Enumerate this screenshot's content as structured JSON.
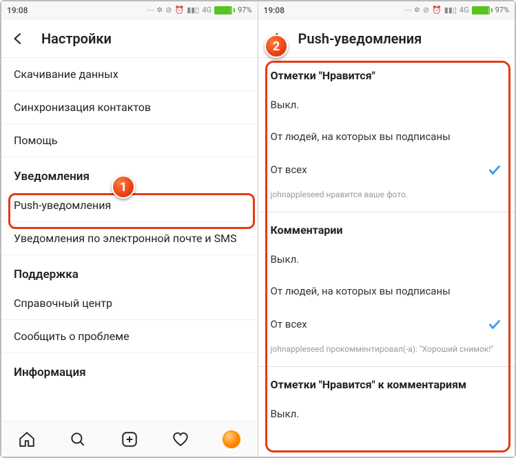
{
  "statusbar": {
    "time": "19:08",
    "network": "4G",
    "battery_pct": "97%"
  },
  "screen_left": {
    "title": "Настройки",
    "rows": {
      "download_data": "Скачивание данных",
      "sync_contacts": "Синхронизация контактов",
      "help": "Помощь"
    },
    "notifications_section": "Уведомления",
    "push_notifications": "Push-уведомления",
    "email_sms_notifications": "Уведомления по электронной почте и SMS",
    "support_section": "Поддержка",
    "help_center": "Справочный центр",
    "report_problem": "Сообщить о проблеме",
    "info_section": "Информация"
  },
  "screen_right": {
    "title": "Push-уведомления",
    "likes": {
      "heading": "Отметки \"Нравится\"",
      "opt_off": "Выкл.",
      "opt_following": "От людей, на которых вы подписаны",
      "opt_everyone": "От всех",
      "caption": "johnappleseed нравится ваше фото."
    },
    "comments": {
      "heading": "Комментарии",
      "opt_off": "Выкл.",
      "opt_following": "От людей, на которых вы подписаны",
      "opt_everyone": "От всех",
      "caption": "johnappleseed прокомментировал(-а): \"Хороший снимок!\""
    },
    "comment_likes": {
      "heading": "Отметки \"Нравится\" к комментариям",
      "opt_off": "Выкл."
    }
  },
  "annotations": {
    "badge1": "1",
    "badge2": "2"
  }
}
